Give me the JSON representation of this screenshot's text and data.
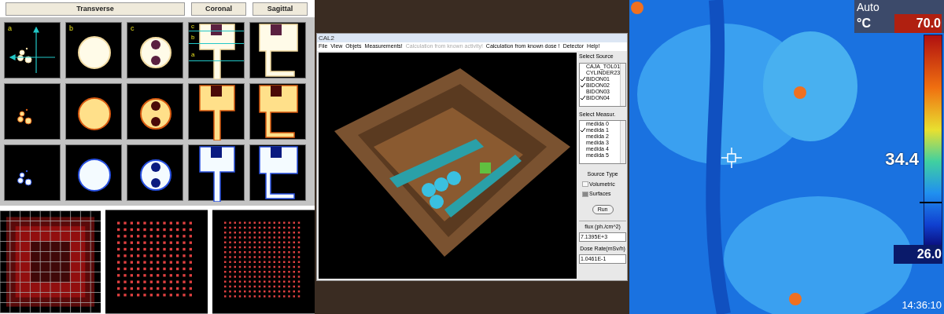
{
  "reconstruction_panel": {
    "headers": [
      {
        "label": "Transverse"
      },
      {
        "label": "Coronal"
      },
      {
        "label": "Sagittal"
      }
    ],
    "transverse_labels": [
      "a",
      "b",
      "c"
    ],
    "coronal_line_labels": [
      "c",
      "b",
      "a"
    ]
  },
  "app_window": {
    "title": "CAL2",
    "menu": [
      {
        "label": "File",
        "disabled": false
      },
      {
        "label": "View",
        "disabled": false
      },
      {
        "label": "Objets",
        "disabled": false
      },
      {
        "label": "Measurements!",
        "disabled": false
      },
      {
        "label": "Calculation from known activity!",
        "disabled": true
      },
      {
        "label": "Calculation from known dose !",
        "disabled": false
      },
      {
        "label": "Detector",
        "disabled": false
      },
      {
        "label": "Help!",
        "disabled": false
      }
    ],
    "source_title": "Select Source",
    "sources": [
      {
        "label": "CAJA_TOL01",
        "checked": false
      },
      {
        "label": "CYLINDER23",
        "checked": false
      },
      {
        "label": "BIDON01",
        "checked": true
      },
      {
        "label": "BIDON02",
        "checked": true
      },
      {
        "label": "BIDON03",
        "checked": false
      },
      {
        "label": "BIDON04",
        "checked": true
      }
    ],
    "measure_title": "Select Measur.",
    "measurements": [
      {
        "label": "medida 0",
        "checked": false
      },
      {
        "label": "medida 1",
        "checked": true
      },
      {
        "label": "medida 2",
        "checked": false
      },
      {
        "label": "medida 3",
        "checked": false
      },
      {
        "label": "medida 4",
        "checked": false
      },
      {
        "label": "medida 5",
        "checked": false
      }
    ],
    "source_type_title": "Source Type",
    "source_types": [
      {
        "label": "Volumetric",
        "selected": false
      },
      {
        "label": "Surfaces",
        "selected": true
      }
    ],
    "run_button": "Run",
    "flux_label": "flux (ph./cm^2)",
    "flux_value": "7.1395E+3",
    "dose_label": "Dose Rate(mSv/h)",
    "dose_value": "1.0461E-1"
  },
  "thermal": {
    "mode": "Auto",
    "unit": "°C",
    "max": "70.0",
    "reading": "34.4",
    "min": "26.0",
    "time": "14:36:10",
    "level": 0.2
  }
}
